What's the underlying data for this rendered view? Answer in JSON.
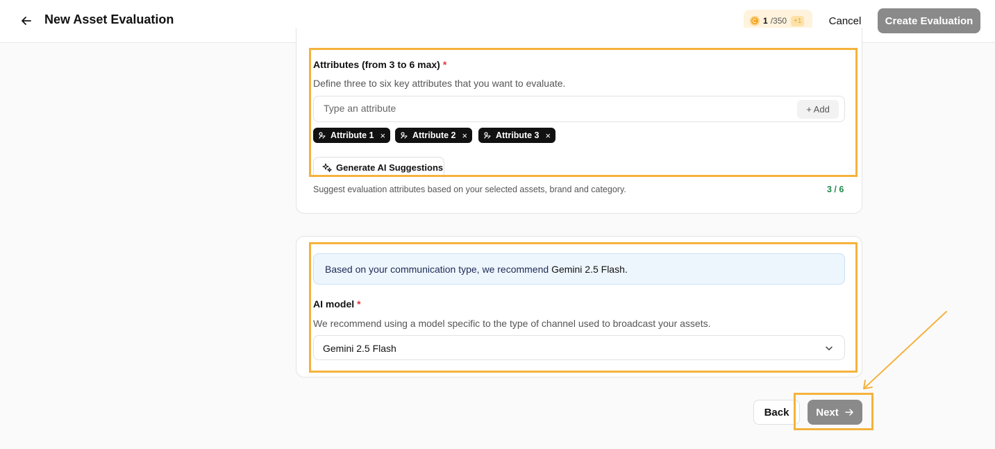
{
  "header": {
    "title": "New Asset Evaluation",
    "credits_used": "1",
    "credits_total": "/350",
    "credits_plus": "+1",
    "cancel_label": "Cancel",
    "create_label": "Create Evaluation",
    "create_button_color": "#8a8a8a",
    "credits_bg_color": "#fff3dd"
  },
  "attributes": {
    "label": "Attributes (from 3 to 6 max)",
    "required_mark": "*",
    "description": "Define three to six key attributes that you want to evaluate.",
    "input_placeholder": "Type an attribute",
    "add_label": "+ Add",
    "chips": [
      "Attribute 1",
      "Attribute 2",
      "Attribute 3"
    ],
    "chip_icon": "tag-icon",
    "remove_glyph": "×",
    "generate_label": "Generate AI Suggestions",
    "hint": "Suggest evaluation attributes based on your selected assets, brand and category.",
    "count": "3 / 6",
    "count_color": "#1f8a4c"
  },
  "model": {
    "recommendation_prefix": "Based on your communication type, we recommend",
    "recommendation_model": "Gemini 2.5 Flash.",
    "label": "AI model",
    "required_mark": "*",
    "description": "We recommend using a model specific to the type of channel used to broadcast your assets.",
    "selected": "Gemini 2.5 Flash"
  },
  "footer": {
    "back_label": "Back",
    "next_label": "Next"
  },
  "annotation_color": "#f5b23c"
}
